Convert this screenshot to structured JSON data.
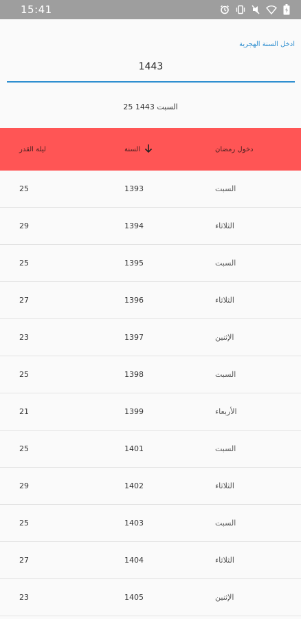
{
  "status_bar": {
    "time": "15:41",
    "icons": [
      "alarm-icon",
      "vibrate-icon",
      "mute-icon",
      "wifi-icon",
      "battery-icon"
    ]
  },
  "input": {
    "label": "ادخل السنة الهجرية",
    "value": "1443"
  },
  "result": {
    "text": "السبت 1443 25"
  },
  "table": {
    "headers": {
      "laila": "ليلة القدر",
      "year": "السنة",
      "entry": "دخول رمضان"
    },
    "sort_icon": "arrow-down-icon",
    "rows": [
      {
        "laila": "25",
        "year": "1393",
        "entry": "السبت"
      },
      {
        "laila": "29",
        "year": "1394",
        "entry": "الثلاثاء"
      },
      {
        "laila": "25",
        "year": "1395",
        "entry": "السبت"
      },
      {
        "laila": "27",
        "year": "1396",
        "entry": "الثلاثاء"
      },
      {
        "laila": "23",
        "year": "1397",
        "entry": "الإثنين"
      },
      {
        "laila": "25",
        "year": "1398",
        "entry": "السبت"
      },
      {
        "laila": "21",
        "year": "1399",
        "entry": "الأربعاء"
      },
      {
        "laila": "25",
        "year": "1401",
        "entry": "السبت"
      },
      {
        "laila": "29",
        "year": "1402",
        "entry": "الثلاثاء"
      },
      {
        "laila": "25",
        "year": "1403",
        "entry": "السبت"
      },
      {
        "laila": "27",
        "year": "1404",
        "entry": "الثلاثاء"
      },
      {
        "laila": "23",
        "year": "1405",
        "entry": "الإثنين"
      }
    ]
  },
  "colors": {
    "header_bg": "#ff5555",
    "accent": "#2f8fd0",
    "status_bar": "#9e9e9e"
  }
}
